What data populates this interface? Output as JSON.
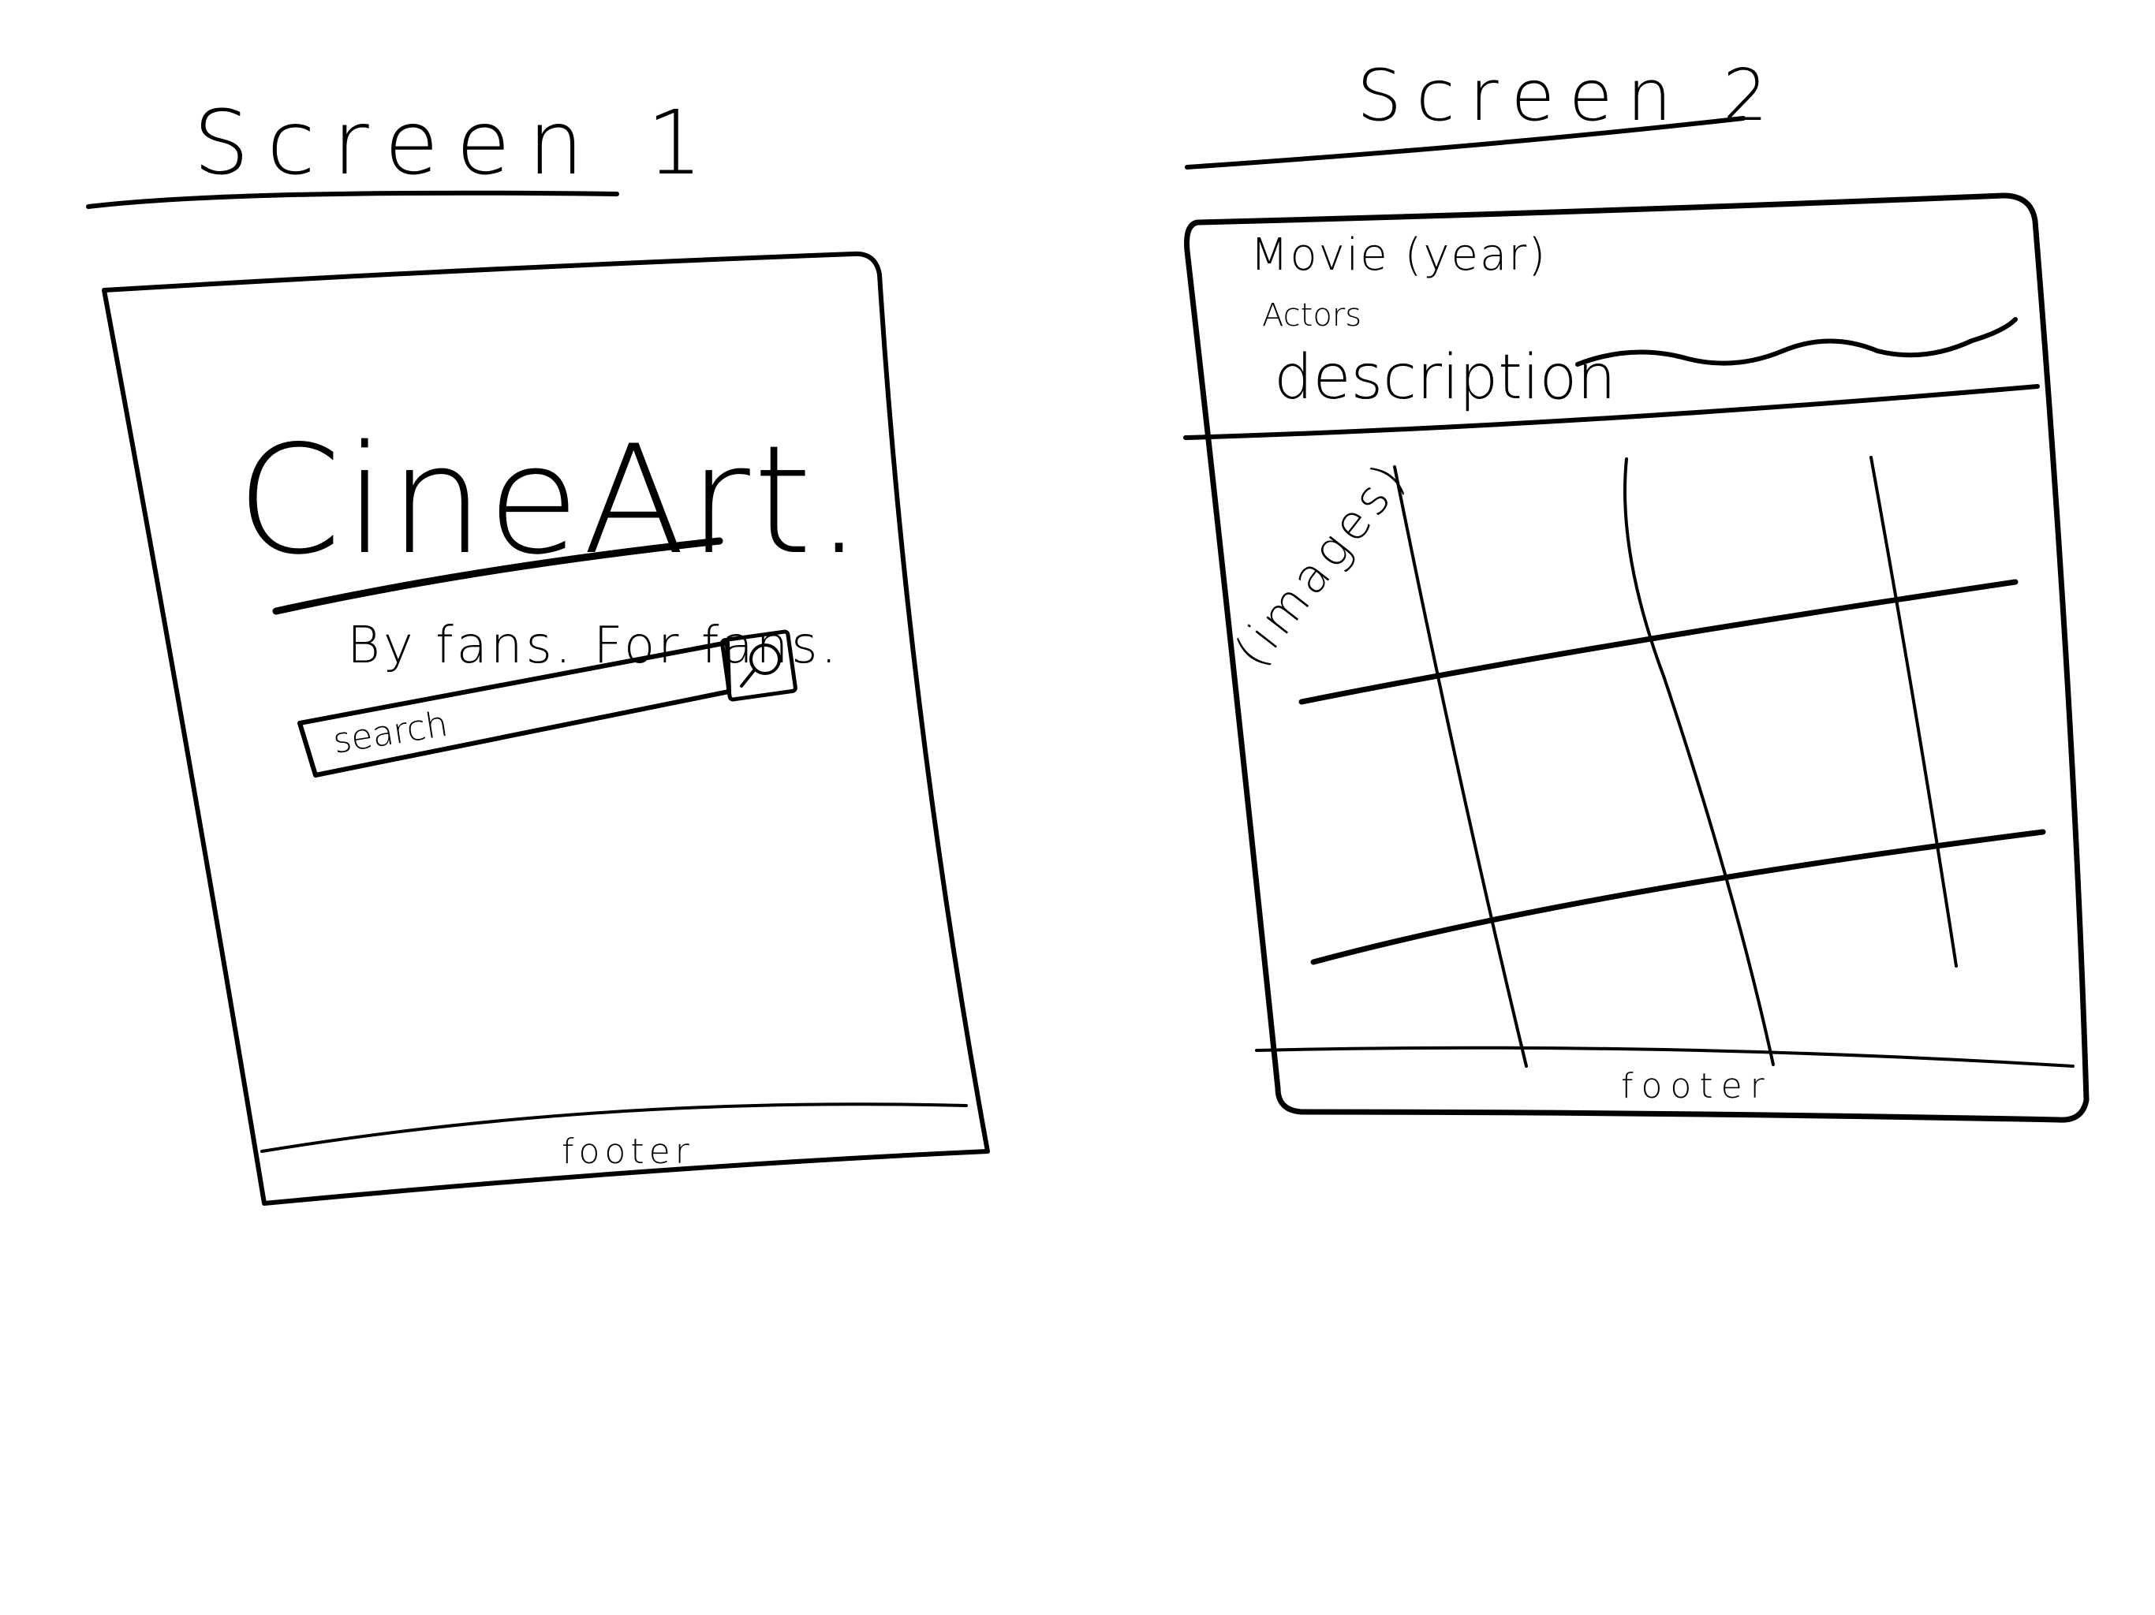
{
  "sketch": {
    "ink_color": "#000000",
    "background_color": "#ffffff"
  },
  "screen1": {
    "heading": "Screen 1",
    "logo": "CineArt.",
    "tagline": "By fans. For fans.",
    "search": {
      "placeholder": "search",
      "button_icon": "search-icon"
    },
    "footer": "footer"
  },
  "screen2": {
    "heading": "Screen 2",
    "header": {
      "title": "Movie (year)",
      "actors": "Actors",
      "description": "description"
    },
    "gallery": {
      "label": "(images)",
      "rows": 3,
      "columns": 4
    },
    "footer": "footer"
  }
}
